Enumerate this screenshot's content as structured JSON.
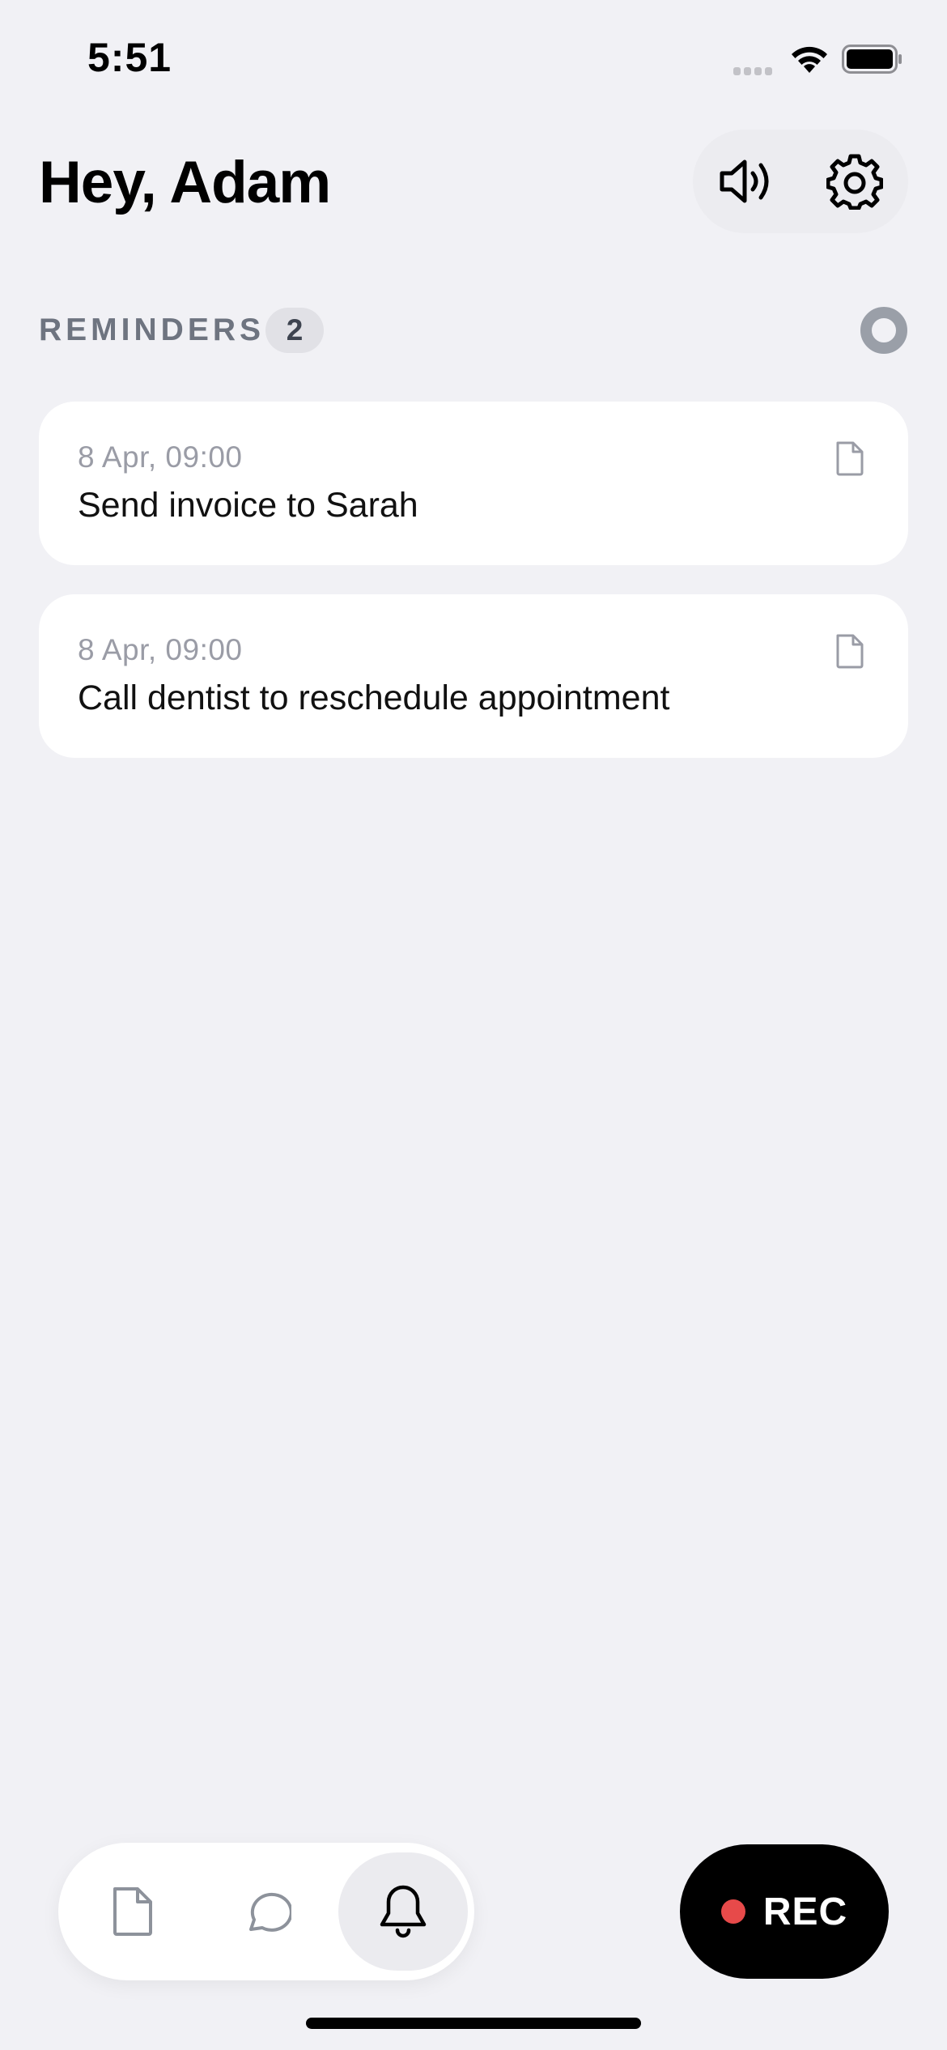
{
  "status_bar": {
    "time": "5:51"
  },
  "header": {
    "title": "Hey, Adam"
  },
  "reminders": {
    "section_title": "REMINDERS",
    "count": "2",
    "items": [
      {
        "date": "8 Apr, 09:00",
        "title": "Send invoice to Sarah"
      },
      {
        "date": "8 Apr, 09:00",
        "title": "Call dentist to reschedule appointment"
      }
    ]
  },
  "bottom_nav": {
    "tabs": [
      {
        "icon": "document-icon",
        "active": false
      },
      {
        "icon": "chat-bubble-icon",
        "active": false
      },
      {
        "icon": "bell-icon",
        "active": true
      }
    ]
  },
  "record_button": {
    "label": "REC"
  },
  "colors": {
    "background": "#f1f1f5",
    "card": "#ffffff",
    "record_dot": "#e74a4a",
    "muted_text": "#9a9ca6",
    "section_text": "#6e7480"
  }
}
